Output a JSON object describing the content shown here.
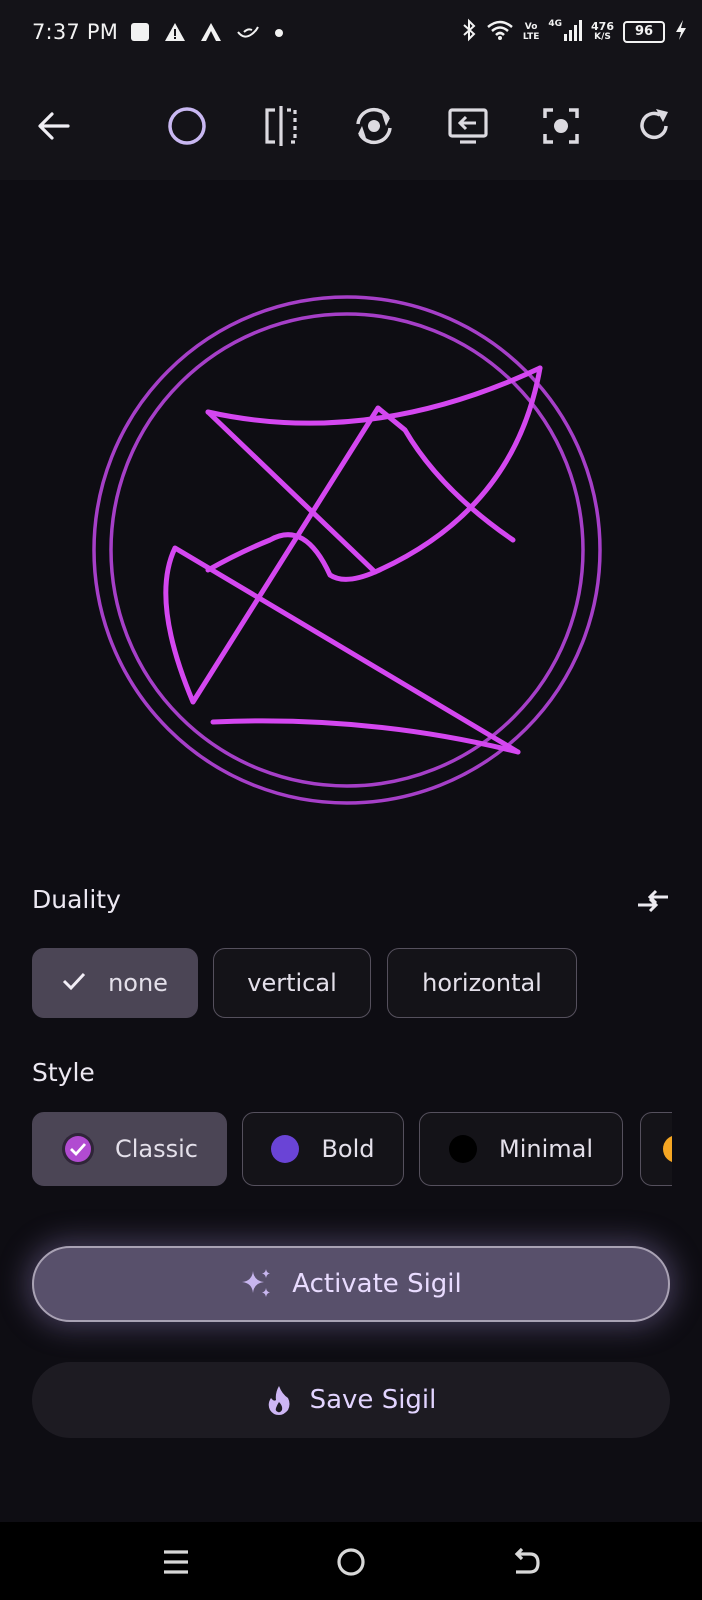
{
  "status_bar": {
    "time": "7:37 PM",
    "left_icons": [
      "square-notification-icon",
      "warning-icon",
      "app-a-icon",
      "bird-icon",
      "dot-icon"
    ],
    "volte_top": "Vo",
    "volte_bottom": "LTE",
    "network": "4G",
    "speed_value": "476",
    "speed_unit": "K/S",
    "battery": "96"
  },
  "toolbar": {
    "icons": [
      "back-arrow-icon",
      "circle-border-icon",
      "mirror-icon",
      "rotate-icon",
      "swap-icon",
      "center-focus-icon",
      "refresh-icon"
    ]
  },
  "sigil": {
    "stroke_color": "#d447f0",
    "ring_color": "#a63fc8"
  },
  "duality": {
    "title": "Duality",
    "options": [
      {
        "label": "none",
        "selected": true
      },
      {
        "label": "vertical",
        "selected": false
      },
      {
        "label": "horizontal",
        "selected": false
      }
    ]
  },
  "style": {
    "title": "Style",
    "options": [
      {
        "label": "Classic",
        "selected": true,
        "color": "#b14bd1"
      },
      {
        "label": "Bold",
        "selected": false,
        "color": "#6a44d6"
      },
      {
        "label": "Minimal",
        "selected": false,
        "color": "#000000"
      }
    ],
    "partial_option_color": "#f5a623"
  },
  "actions": {
    "activate_label": "Activate Sigil",
    "save_label": "Save Sigil"
  },
  "nav": {
    "icons": [
      "menu-icon",
      "home-icon",
      "back-icon"
    ]
  }
}
